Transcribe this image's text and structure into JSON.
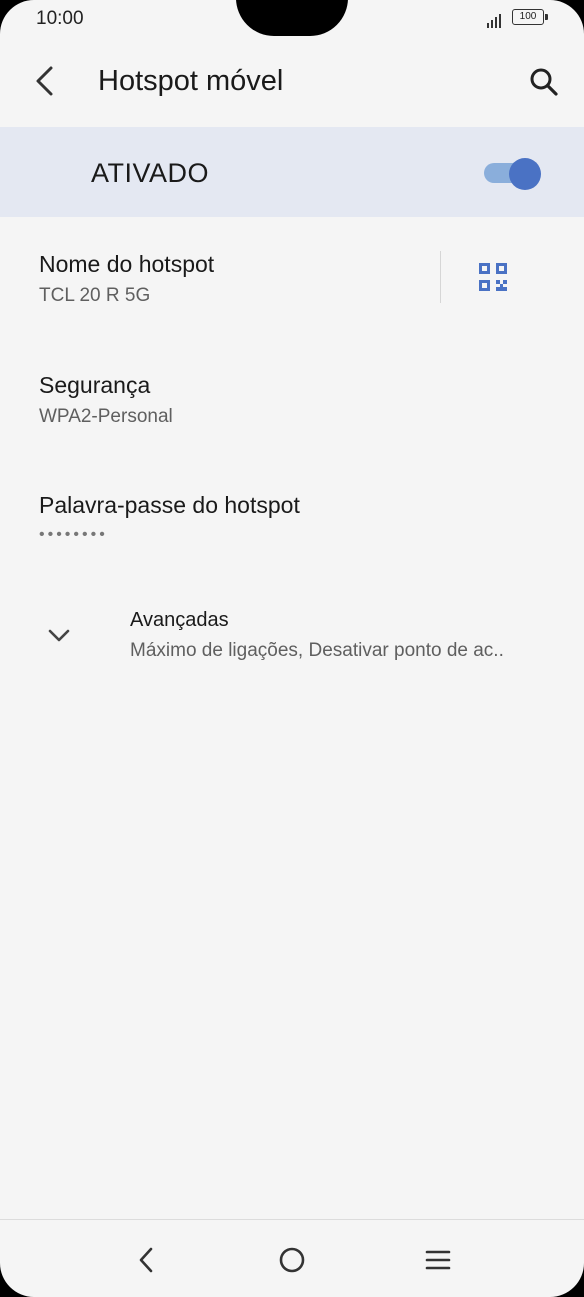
{
  "status_bar": {
    "time": "10:00",
    "battery": "100"
  },
  "header": {
    "title": "Hotspot móvel",
    "icons": {
      "back": "arrow-back-icon",
      "search": "search-icon"
    }
  },
  "toggle": {
    "label": "ATIVADO",
    "state": "on",
    "track_color": "#8aaedb",
    "thumb_color": "#4a72c4"
  },
  "settings": {
    "hotspot_name": {
      "title": "Nome do hotspot",
      "value": "TCL 20 R 5G",
      "icon": "qr-code-icon"
    },
    "security": {
      "title": "Segurança",
      "value": "WPA2-Personal"
    },
    "password": {
      "title": "Palavra-passe do hotspot",
      "value": "••••••••"
    },
    "advanced": {
      "title": "Avançadas",
      "value": "Máximo de ligações, Desativar ponto de ac..",
      "icon": "chevron-down-icon"
    }
  },
  "nav_bar": {
    "icons": [
      "back-icon",
      "home-icon",
      "recents-menu-icon"
    ]
  },
  "colors": {
    "background": "#f5f5f5",
    "toggle_row": "#e4e8f2",
    "accent": "#4a72c4"
  }
}
